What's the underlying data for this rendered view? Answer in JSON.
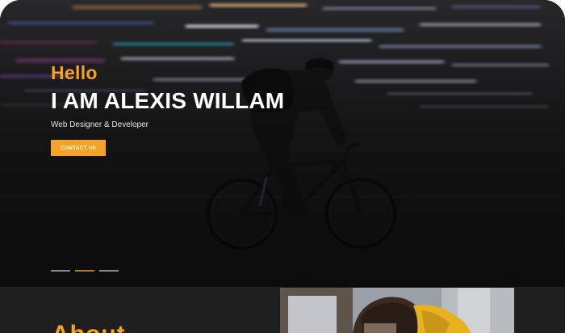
{
  "hero": {
    "greeting": "Hello",
    "name": "I AM ALEXIS WILLAM",
    "role": "Web Designer & Developer",
    "cta_label": "CONTACT US",
    "slider": {
      "count": 3,
      "active_index": 1
    }
  },
  "about": {
    "heading": "About"
  },
  "colors": {
    "accent": "#f5a322",
    "background": "#1e1e1f",
    "text": "#ffffff"
  }
}
